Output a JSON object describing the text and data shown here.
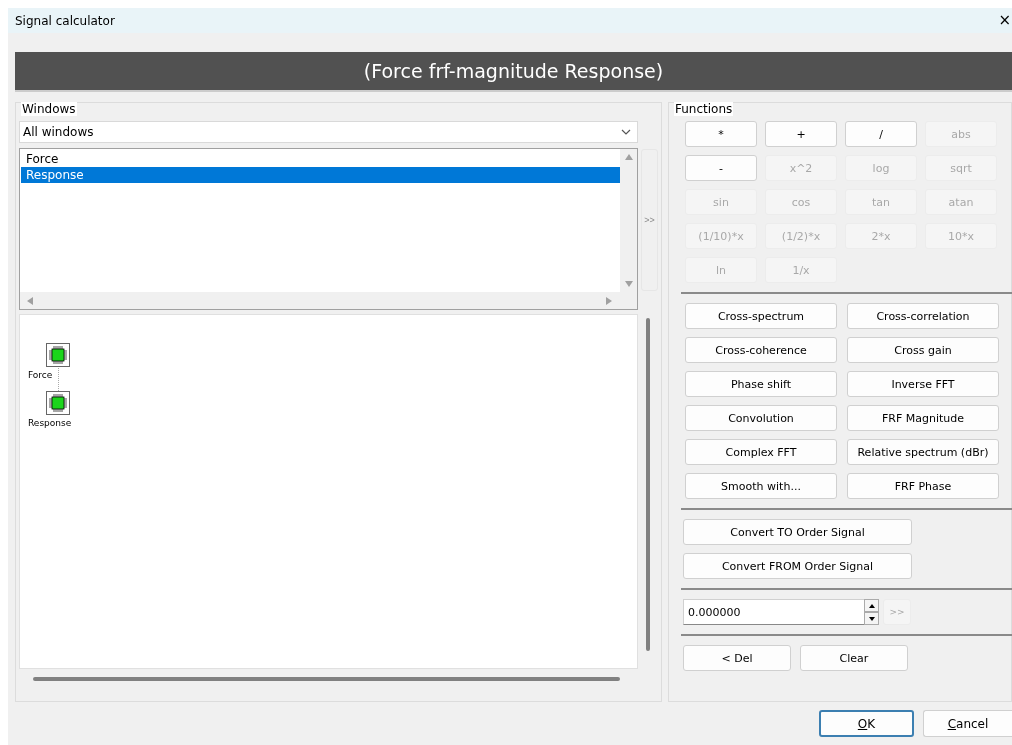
{
  "window": {
    "title": "Signal calculator",
    "close": "×"
  },
  "expression": "(Force frf-magnitude Response)",
  "windows_group": {
    "label": "Windows",
    "filter": {
      "value": "All windows"
    },
    "list": [
      {
        "label": "Force",
        "selected": false
      },
      {
        "label": "Response",
        "selected": true
      }
    ],
    "add_button": {
      "label": ">>",
      "disabled": true
    },
    "diagram": [
      {
        "label": "Force"
      },
      {
        "label": "Response"
      }
    ]
  },
  "functions_group": {
    "label": "Functions",
    "operators": [
      {
        "label": "*",
        "disabled": false
      },
      {
        "label": "+",
        "disabled": false
      },
      {
        "label": "/",
        "disabled": false
      },
      {
        "label": "abs",
        "disabled": true
      },
      {
        "label": "-",
        "disabled": false
      },
      {
        "label": "x^2",
        "disabled": true
      },
      {
        "label": "log",
        "disabled": true
      },
      {
        "label": "sqrt",
        "disabled": true
      },
      {
        "label": "sin",
        "disabled": true
      },
      {
        "label": "cos",
        "disabled": true
      },
      {
        "label": "tan",
        "disabled": true
      },
      {
        "label": "atan",
        "disabled": true
      },
      {
        "label": "(1/10)*x",
        "disabled": true
      },
      {
        "label": "(1/2)*x",
        "disabled": true
      },
      {
        "label": "2*x",
        "disabled": true
      },
      {
        "label": "10*x",
        "disabled": true
      },
      {
        "label": "ln",
        "disabled": true
      },
      {
        "label": "1/x",
        "disabled": true
      }
    ],
    "signal_functions": [
      {
        "label": "Cross-spectrum",
        "disabled": false
      },
      {
        "label": "Cross-correlation",
        "disabled": false
      },
      {
        "label": "Cross-coherence",
        "disabled": false
      },
      {
        "label": "Cross gain",
        "disabled": false
      },
      {
        "label": "Phase shift",
        "disabled": false
      },
      {
        "label": "Inverse FFT",
        "disabled": false
      },
      {
        "label": "Convolution",
        "disabled": false
      },
      {
        "label": "FRF Magnitude",
        "disabled": false
      },
      {
        "label": "Complex FFT",
        "disabled": false
      },
      {
        "label": "Relative spectrum (dBr)",
        "disabled": false
      },
      {
        "label": "Smooth with...",
        "disabled": false
      },
      {
        "label": "FRF Phase",
        "disabled": false
      }
    ],
    "order_functions": [
      {
        "label": "Convert TO Order Signal"
      },
      {
        "label": "Convert FROM Order Signal"
      }
    ],
    "constant": {
      "value": "0.000000",
      "insert_button": {
        "label": ">>",
        "disabled": true
      }
    },
    "edit_buttons": [
      {
        "label": "< Del"
      },
      {
        "label": "Clear"
      }
    ]
  },
  "dialog_buttons": [
    {
      "label": "OK",
      "default": true,
      "underline_first": true
    },
    {
      "label": "Cancel",
      "default": false,
      "underline_first": true
    }
  ]
}
